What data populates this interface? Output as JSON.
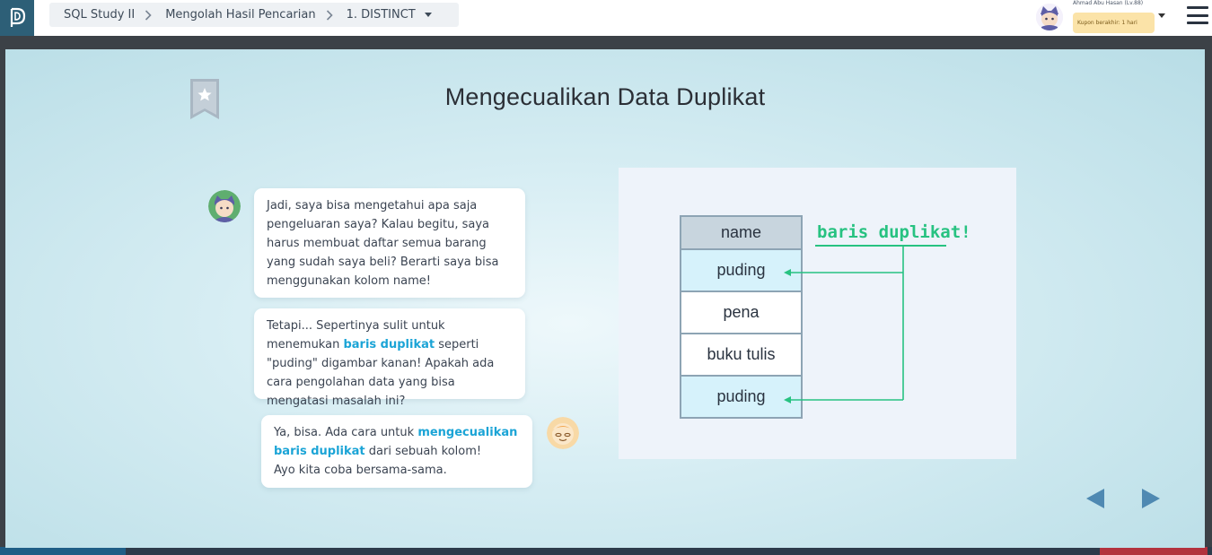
{
  "topbar": {
    "breadcrumb": [
      "SQL Study II",
      "Mengolah Hasil Pencarian",
      "1. DISTINCT"
    ],
    "user_name": "Ahmad Abu Hasan (Lv.88)",
    "coupon": "Kupon berakhir: 1 hari"
  },
  "slide": {
    "title": "Mengecualikan Data Duplikat",
    "bubble1": "Jadi, saya bisa mengetahui apa saja pengeluaran saya? Kalau begitu, saya harus membuat daftar semua barang yang sudah saya beli? Berarti saya bisa menggunakan kolom name!",
    "bubble2": {
      "pre": "Tetapi... Sepertinya sulit untuk menemukan ",
      "hl": "baris duplikat",
      "post": " seperti \"puding\" digambar kanan! Apakah ada cara pengolahan data yang bisa mengatasi masalah ini?"
    },
    "bubble3": {
      "pre": "Ya, bisa. Ada cara untuk ",
      "hl": "mengecualikan baris duplikat",
      "post": " dari sebuah kolom!",
      "line2": "Ayo kita coba bersama-sama."
    },
    "diagram": {
      "header": "name",
      "rows": [
        "puding",
        "pena",
        "buku tulis",
        "puding"
      ],
      "label": "baris duplikat!"
    }
  },
  "colors": {
    "accent": "#1ba4d6",
    "dup_green": "#27c281",
    "logo_bg": "#2d5f77"
  }
}
